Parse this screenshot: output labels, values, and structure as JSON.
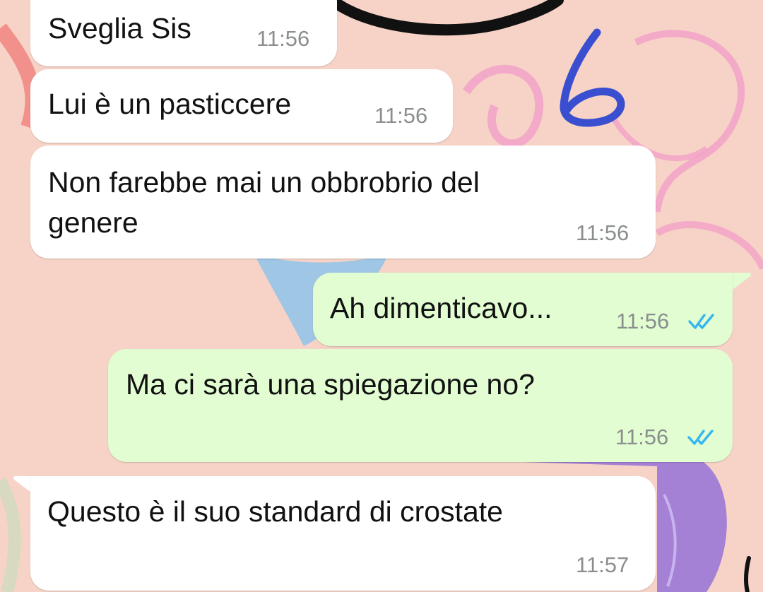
{
  "colors": {
    "wallpaper": "#f7d3c7",
    "incoming_bubble": "#ffffff",
    "outgoing_bubble": "#e2fdd2",
    "timestamp": "#8a8f8d",
    "read_ticks": "#34b7f1",
    "annotation_ink": "#3a4fd0"
  },
  "annotation": {
    "text": "6"
  },
  "messages": [
    {
      "direction": "incoming",
      "text": "Sveglia Sis",
      "time": "11:56"
    },
    {
      "direction": "incoming",
      "text": "Lui è un pasticcere",
      "time": "11:56"
    },
    {
      "direction": "incoming",
      "lines": [
        "Non farebbe mai un obbrobrio del",
        "genere"
      ],
      "time": "11:56"
    },
    {
      "direction": "outgoing",
      "text": "Ah dimenticavo...",
      "time": "11:56",
      "status": "read",
      "status_icon": "double-check-icon"
    },
    {
      "direction": "outgoing",
      "text": "Ma ci sarà una spiegazione no?",
      "time": "11:56",
      "status": "read",
      "status_icon": "double-check-icon"
    },
    {
      "direction": "incoming",
      "text": "Questo è il suo standard di crostate",
      "time": "11:57"
    }
  ]
}
